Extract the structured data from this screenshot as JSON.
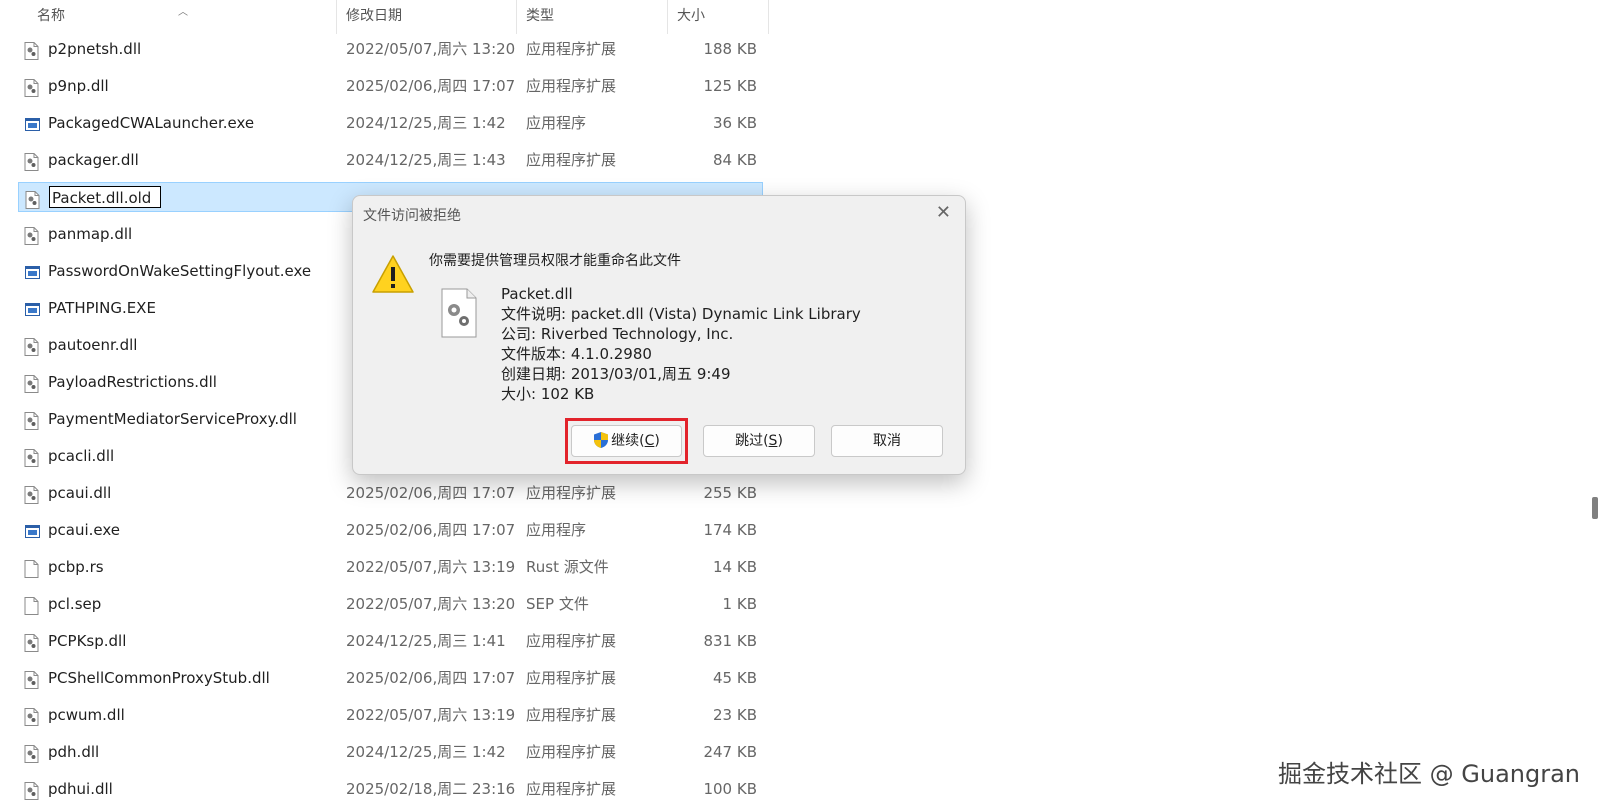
{
  "header": {
    "name": "名称",
    "date": "修改日期",
    "type": "类型",
    "size": "大小"
  },
  "files": [
    {
      "name": "p2pnetsh.dll",
      "date": "2022/05/07,周六 13:20",
      "type": "应用程序扩展",
      "size": "188 KB",
      "icon": "dll-file-icon"
    },
    {
      "name": "p9np.dll",
      "date": "2025/02/06,周四 17:07",
      "type": "应用程序扩展",
      "size": "125 KB",
      "icon": "dll-file-icon"
    },
    {
      "name": "PackagedCWALauncher.exe",
      "date": "2024/12/25,周三 1:42",
      "type": "应用程序",
      "size": "36 KB",
      "icon": "exe-file-icon"
    },
    {
      "name": "packager.dll",
      "date": "2024/12/25,周三 1:43",
      "type": "应用程序扩展",
      "size": "84 KB",
      "icon": "dll-file-icon"
    },
    {
      "name": "Packet.dll.old",
      "date": "",
      "type": "",
      "size": "",
      "icon": "dll-file-icon",
      "selected": true
    },
    {
      "name": "panmap.dll",
      "date": "",
      "type": "",
      "size": "",
      "icon": "dll-file-icon"
    },
    {
      "name": "PasswordOnWakeSettingFlyout.exe",
      "date": "",
      "type": "",
      "size": "",
      "icon": "exe-file-icon"
    },
    {
      "name": "PATHPING.EXE",
      "date": "",
      "type": "",
      "size": "",
      "icon": "exe-file-icon"
    },
    {
      "name": "pautoenr.dll",
      "date": "",
      "type": "",
      "size": "",
      "icon": "dll-file-icon"
    },
    {
      "name": "PayloadRestrictions.dll",
      "date": "",
      "type": "",
      "size": "",
      "icon": "dll-file-icon"
    },
    {
      "name": "PaymentMediatorServiceProxy.dll",
      "date": "",
      "type": "",
      "size": "",
      "icon": "dll-file-icon"
    },
    {
      "name": "pcacli.dll",
      "date": "",
      "type": "",
      "size": "",
      "icon": "dll-file-icon"
    },
    {
      "name": "pcaui.dll",
      "date": "2025/02/06,周四 17:07",
      "type": "应用程序扩展",
      "size": "255 KB",
      "icon": "dll-file-icon"
    },
    {
      "name": "pcaui.exe",
      "date": "2025/02/06,周四 17:07",
      "type": "应用程序",
      "size": "174 KB",
      "icon": "exe-file-icon"
    },
    {
      "name": "pcbp.rs",
      "date": "2022/05/07,周六 13:19",
      "type": "Rust 源文件",
      "size": "14 KB",
      "icon": "blank-file-icon"
    },
    {
      "name": "pcl.sep",
      "date": "2022/05/07,周六 13:20",
      "type": "SEP 文件",
      "size": "1 KB",
      "icon": "blank-file-icon"
    },
    {
      "name": "PCPKsp.dll",
      "date": "2024/12/25,周三 1:41",
      "type": "应用程序扩展",
      "size": "831 KB",
      "icon": "dll-file-icon"
    },
    {
      "name": "PCShellCommonProxyStub.dll",
      "date": "2025/02/06,周四 17:07",
      "type": "应用程序扩展",
      "size": "45 KB",
      "icon": "dll-file-icon"
    },
    {
      "name": "pcwum.dll",
      "date": "2022/05/07,周六 13:19",
      "type": "应用程序扩展",
      "size": "23 KB",
      "icon": "dll-file-icon"
    },
    {
      "name": "pdh.dll",
      "date": "2024/12/25,周三 1:42",
      "type": "应用程序扩展",
      "size": "247 KB",
      "icon": "dll-file-icon"
    },
    {
      "name": "pdhui.dll",
      "date": "2025/02/18,周二 23:16",
      "type": "应用程序扩展",
      "size": "100 KB",
      "icon": "dll-file-icon"
    }
  ],
  "dialog": {
    "title": "文件访问被拒绝",
    "close_glyph": "✕",
    "message": "你需要提供管理员权限才能重命名此文件",
    "file_name": "Packet.dll",
    "description": "文件说明: packet.dll (Vista) Dynamic Link Library",
    "company": "公司: Riverbed Technology, Inc.",
    "version": "文件版本: 4.1.0.2980",
    "created": "创建日期: 2013/03/01,周五 9:49",
    "size": "大小: 102 KB",
    "continue_label": "继续(",
    "continue_key": "C",
    "skip_label": "跳过(",
    "skip_key": "S",
    "cancel_label": "取消",
    "close_paren": ")"
  },
  "watermark": "掘金技术社区 @ Guangran",
  "colors": {
    "selection": "#cce8ff",
    "highlight_box": "#e2232b"
  }
}
